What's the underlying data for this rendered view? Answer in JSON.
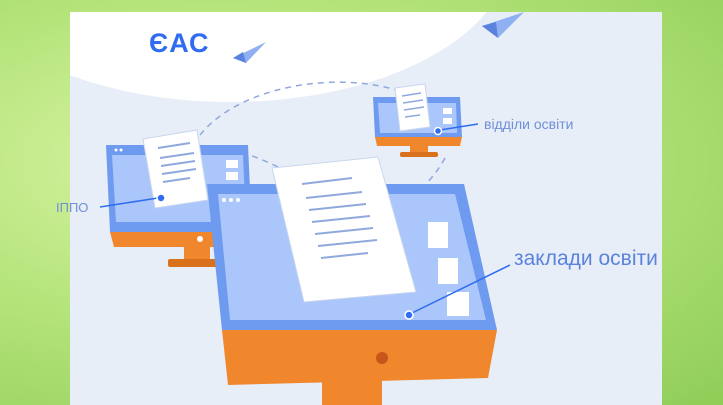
{
  "brand": {
    "logo_text": "ЄАС"
  },
  "labels": {
    "ippo": "ІППО",
    "viddily_osvity": "відділи освіти",
    "zaklady_osvity": "заклади освіти"
  },
  "colors": {
    "border_green": "#9cd46a",
    "panel_bg": "#e8eef8",
    "brand_blue": "#2f6cf0",
    "screen_blue": "#6e9bf0",
    "screen_light": "#aac6fa",
    "stand_orange": "#f0872d",
    "label_blue": "#6f8fd8"
  },
  "icons": [
    "paper-plane-icon",
    "paper-plane-icon",
    "document-icon",
    "monitor-icon"
  ]
}
